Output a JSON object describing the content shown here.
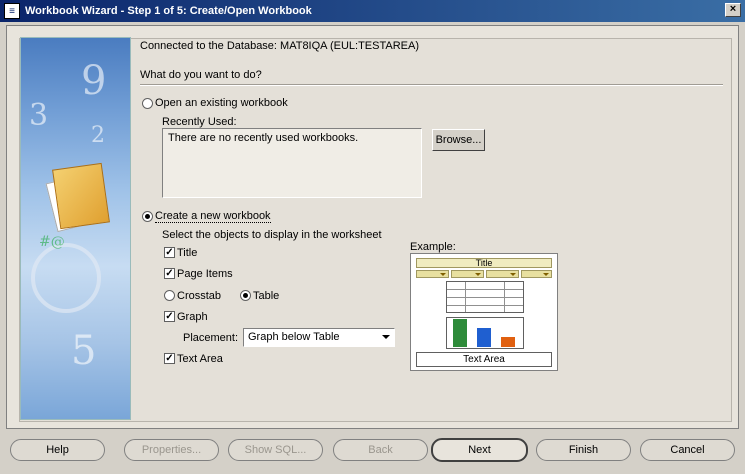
{
  "window": {
    "title": "Workbook Wizard - Step 1 of 5: Create/Open Workbook",
    "close_label": "×"
  },
  "connection": "Connected to the Database: MAT8IQA (EUL:TESTAREA)",
  "question": "What do you want to do?",
  "open_option": {
    "label": "Open an existing workbook",
    "selected": false,
    "recently_used_label": "Recently Used:",
    "recent_items": [
      "There are no recently used workbooks."
    ],
    "browse_label": "Browse..."
  },
  "create_option": {
    "label": "Create a new workbook",
    "selected": true,
    "instructions": "Select the objects to display in the worksheet",
    "objects": {
      "title": {
        "label": "Title",
        "checked": true
      },
      "page_items": {
        "label": "Page Items",
        "checked": true
      },
      "crosstab": {
        "label": "Crosstab",
        "selected": false
      },
      "table": {
        "label": "Table",
        "selected": true
      },
      "graph": {
        "label": "Graph",
        "checked": true
      },
      "text_area": {
        "label": "Text Area",
        "checked": true
      }
    },
    "placement_label": "Placement:",
    "placement_value": "Graph below Table"
  },
  "example": {
    "label": "Example:",
    "title_text": "Title",
    "text_area_text": "Text Area",
    "bar_colors": [
      "#2e8b3a",
      "#1f5fd0",
      "#e06010"
    ]
  },
  "footer": {
    "help": "Help",
    "properties": "Properties...",
    "show_sql": "Show SQL...",
    "back": "Back",
    "next": "Next",
    "finish": "Finish",
    "cancel": "Cancel"
  }
}
